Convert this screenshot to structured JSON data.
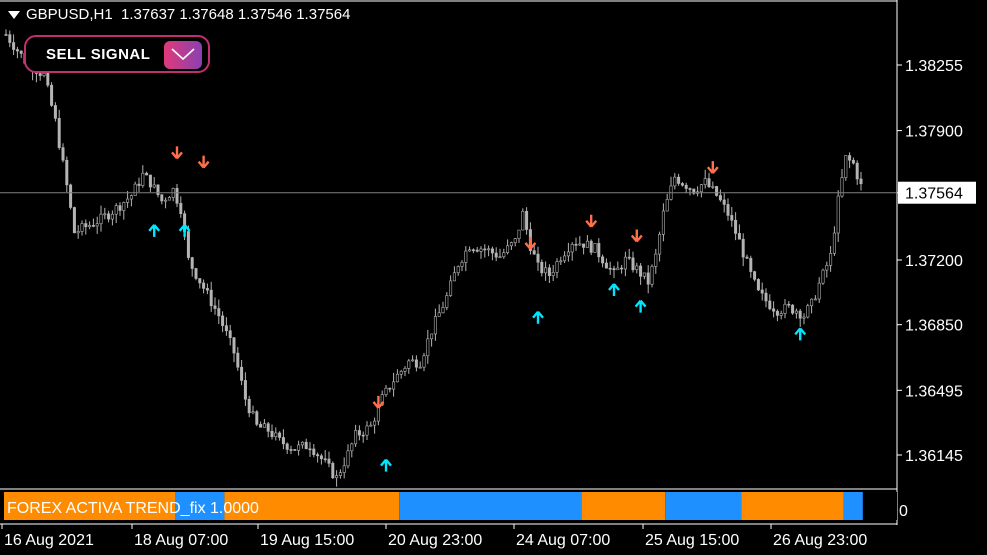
{
  "header": {
    "symbol": "GBPUSD,H1",
    "ohlc": "1.37637 1.37648 1.37546 1.37564"
  },
  "signal_box": {
    "label": "SELL SIGNAL",
    "icon": "envelope-icon"
  },
  "indicator": {
    "label": "FOREX ACTIVA TREND_fix 1.0000",
    "right_glyph": "0"
  },
  "colors": {
    "candle": "#b4b4b4",
    "up_arrow": "#00e5ff",
    "down_arrow": "#ff6f4a",
    "orange": "#ff8c00",
    "blue": "#1e90ff",
    "grid": "#808080"
  },
  "chart_data": {
    "type": "candlestick",
    "price_axis": {
      "ticks": [
        "1.38255",
        "1.37900",
        "1.37564",
        "1.37200",
        "1.36850",
        "1.36495",
        "1.36145"
      ],
      "current": "1.37564"
    },
    "time_axis": [
      "16 Aug 2021",
      "18 Aug 07:00",
      "19 Aug 15:00",
      "20 Aug 23:00",
      "24 Aug 07:00",
      "25 Aug 15:00",
      "26 Aug 23:00"
    ],
    "close_path": [
      [
        0,
        1.3842
      ],
      [
        5,
        1.3828
      ],
      [
        10,
        1.382
      ],
      [
        13,
        1.3795
      ],
      [
        16,
        1.376
      ],
      [
        18,
        1.3735
      ],
      [
        21,
        1.3738
      ],
      [
        25,
        1.3742
      ],
      [
        29,
        1.3748
      ],
      [
        33,
        1.3755
      ],
      [
        36,
        1.3766
      ],
      [
        38,
        1.3762
      ],
      [
        41,
        1.3752
      ],
      [
        44,
        1.3758
      ],
      [
        46,
        1.3748
      ],
      [
        48,
        1.372
      ],
      [
        52,
        1.3705
      ],
      [
        56,
        1.369
      ],
      [
        60,
        1.367
      ],
      [
        63,
        1.3645
      ],
      [
        66,
        1.363
      ],
      [
        69,
        1.3628
      ],
      [
        72,
        1.3622
      ],
      [
        76,
        1.3618
      ],
      [
        80,
        1.362
      ],
      [
        84,
        1.361
      ],
      [
        87,
        1.3602
      ],
      [
        90,
        1.3615
      ],
      [
        92,
        1.3625
      ],
      [
        96,
        1.363
      ],
      [
        99,
        1.3645
      ],
      [
        102,
        1.3655
      ],
      [
        106,
        1.3665
      ],
      [
        109,
        1.3665
      ],
      [
        112,
        1.3682
      ],
      [
        116,
        1.37
      ],
      [
        119,
        1.3718
      ],
      [
        122,
        1.3728
      ],
      [
        126,
        1.3726
      ],
      [
        130,
        1.3722
      ],
      [
        134,
        1.373
      ],
      [
        136,
        1.3745
      ],
      [
        138,
        1.3728
      ],
      [
        140,
        1.3716
      ],
      [
        143,
        1.3712
      ],
      [
        146,
        1.3722
      ],
      [
        149,
        1.373
      ],
      [
        152,
        1.3729
      ],
      [
        155,
        1.3726
      ],
      [
        158,
        1.3718
      ],
      [
        160,
        1.3712
      ],
      [
        163,
        1.372
      ],
      [
        166,
        1.3715
      ],
      [
        169,
        1.3708
      ],
      [
        171,
        1.3722
      ],
      [
        173,
        1.3745
      ],
      [
        176,
        1.3765
      ],
      [
        178,
        1.3762
      ],
      [
        181,
        1.3758
      ],
      [
        184,
        1.3762
      ],
      [
        187,
        1.3755
      ],
      [
        190,
        1.3745
      ],
      [
        193,
        1.373
      ],
      [
        196,
        1.3712
      ],
      [
        198,
        1.3702
      ],
      [
        201,
        1.3696
      ],
      [
        203,
        1.3693
      ],
      [
        206,
        1.3694
      ],
      [
        208,
        1.3693
      ],
      [
        210,
        1.369
      ],
      [
        212,
        1.3696
      ],
      [
        214,
        1.3707
      ],
      [
        217,
        1.3722
      ],
      [
        219,
        1.3752
      ],
      [
        221,
        1.3775
      ],
      [
        223,
        1.3772
      ],
      [
        225,
        1.376
      ]
    ],
    "buy_arrows": [
      [
        39,
        1.3739
      ],
      [
        47,
        1.3739
      ],
      [
        100,
        1.3612
      ],
      [
        140,
        1.3692
      ],
      [
        160,
        1.3707
      ],
      [
        167,
        1.3698
      ],
      [
        209,
        1.3683
      ]
    ],
    "sell_arrows": [
      [
        45,
        1.3775
      ],
      [
        52,
        1.377
      ],
      [
        98,
        1.364
      ],
      [
        138,
        1.3726
      ],
      [
        154,
        1.3738
      ],
      [
        166,
        1.373
      ],
      [
        186,
        1.3767
      ]
    ],
    "indicator_segments": [
      [
        "orange",
        0,
        45
      ],
      [
        "blue",
        45,
        58
      ],
      [
        "orange",
        58,
        104
      ],
      [
        "blue",
        104,
        152
      ],
      [
        "orange",
        152,
        174
      ],
      [
        "blue",
        174,
        194
      ],
      [
        "orange",
        194,
        221
      ],
      [
        "blue",
        221,
        226
      ]
    ]
  }
}
